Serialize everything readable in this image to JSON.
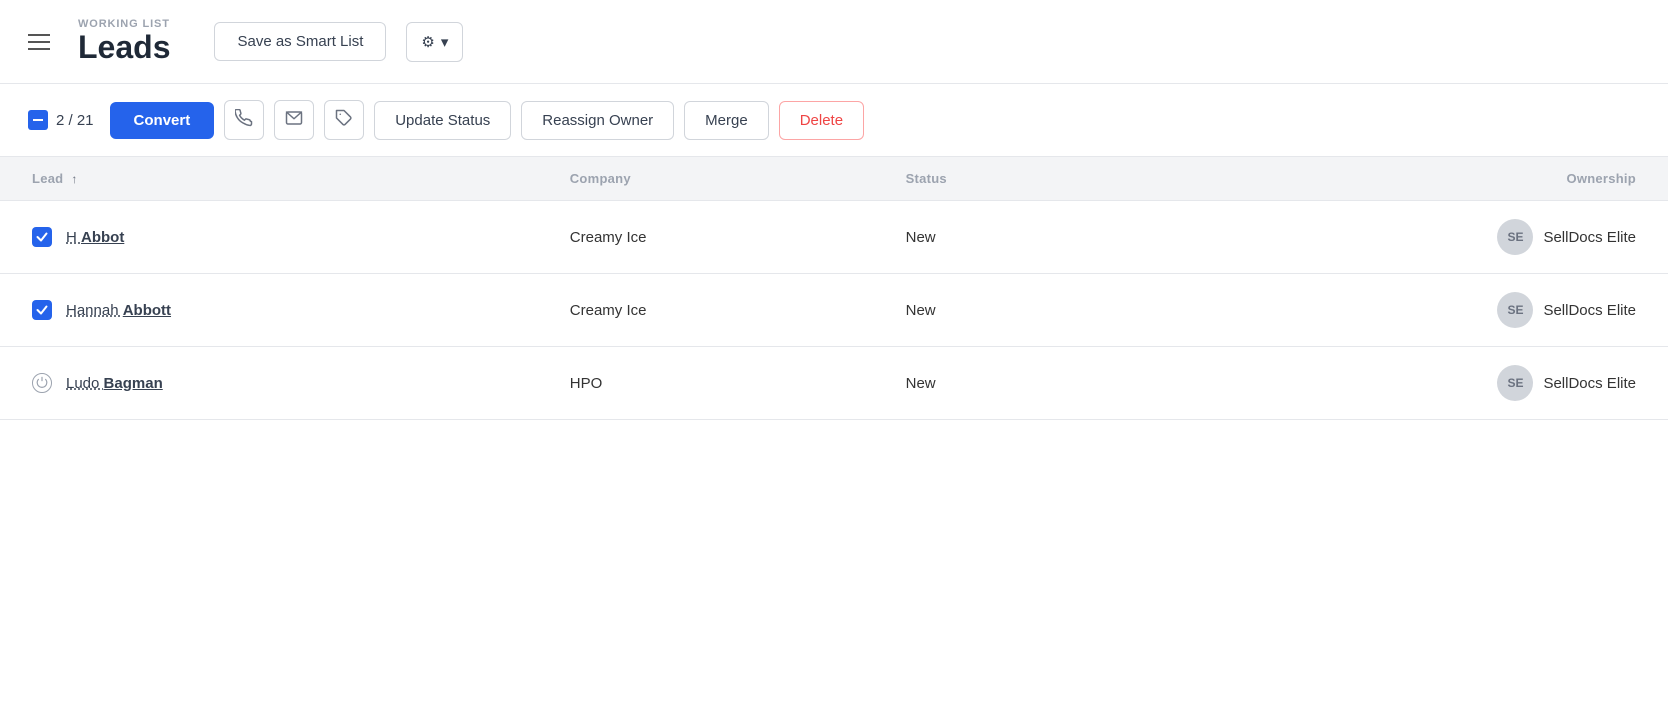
{
  "header": {
    "menu_icon_label": "menu",
    "working_list_label": "WORKING LIST",
    "page_title": "Leads",
    "save_smart_list_label": "Save as Smart List",
    "gear_label": "⚙",
    "chevron_label": "▾"
  },
  "toolbar": {
    "selected_count": "2 / 21",
    "convert_label": "Convert",
    "phone_icon": "☎",
    "email_icon": "✉",
    "tag_icon": "🏷",
    "update_status_label": "Update Status",
    "reassign_owner_label": "Reassign Owner",
    "merge_label": "Merge",
    "delete_label": "Delete"
  },
  "table": {
    "columns": [
      {
        "key": "lead",
        "label": "Lead",
        "sortable": true
      },
      {
        "key": "company",
        "label": "Company",
        "sortable": false
      },
      {
        "key": "status",
        "label": "Status",
        "sortable": false
      },
      {
        "key": "ownership",
        "label": "Ownership",
        "sortable": false
      }
    ],
    "rows": [
      {
        "checked": true,
        "first_name": "H",
        "last_name": "Abbot",
        "company": "Creamy Ice",
        "status": "New",
        "avatar_initials": "SE",
        "owner": "SellDocs Elite"
      },
      {
        "checked": true,
        "first_name": "Hannah",
        "last_name": "Abbott",
        "company": "Creamy Ice",
        "status": "New",
        "avatar_initials": "SE",
        "owner": "SellDocs Elite"
      },
      {
        "checked": false,
        "first_name": "Ludo",
        "last_name": "Bagman",
        "company": "HPO",
        "status": "New",
        "avatar_initials": "SE",
        "owner": "SellDocs Elite"
      }
    ]
  },
  "colors": {
    "accent": "#2563eb",
    "delete": "#ef4444"
  }
}
